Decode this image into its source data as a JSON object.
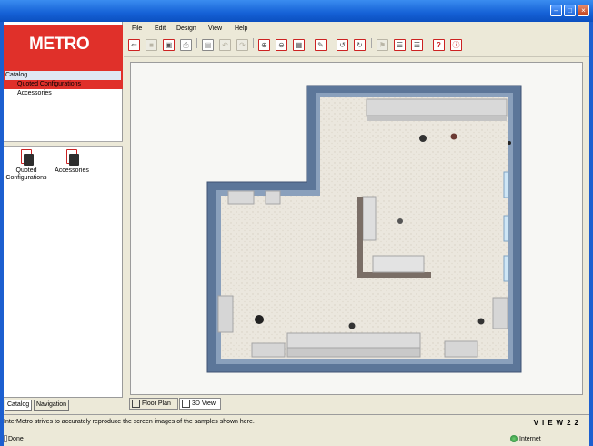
{
  "window": {
    "buttons": [
      "minimize",
      "maximize",
      "close"
    ]
  },
  "brand": {
    "logo": "METRO",
    "wordmark": "VIEW22"
  },
  "menu": [
    "File",
    "Edit",
    "Design",
    "View",
    "Help"
  ],
  "tree": {
    "root": "Catalog",
    "children": [
      "Quoted Configurations",
      "Accessories"
    ]
  },
  "icons": [
    {
      "label": "Quoted Configurations"
    },
    {
      "label": "Accessories"
    }
  ],
  "left_tabs": [
    "Catalog",
    "Navigation"
  ],
  "toolbar_icons": [
    "new-icon",
    "stop-icon",
    "save-icon",
    "print-icon",
    "delete-icon",
    "undo-icon",
    "redo-icon",
    "zoom-in-icon",
    "zoom-out-icon",
    "fit-icon",
    "paint-icon",
    "rotate-left-icon",
    "rotate-right-icon",
    "flag-icon",
    "list-icon",
    "list2-icon",
    "help-icon",
    "info-icon"
  ],
  "view_tabs": [
    "Floor Plan",
    "3D View"
  ],
  "info_message": "InterMetro strives to accurately reproduce the screen images of the samples shown here.",
  "status": {
    "left": "Done",
    "right": "Internet"
  },
  "colors": {
    "titlebar": "#1561d6",
    "logo_bg": "#e0302a",
    "wall": "#5b7598",
    "floor": "#e8e4da",
    "fixture": "#dcdcdc"
  }
}
